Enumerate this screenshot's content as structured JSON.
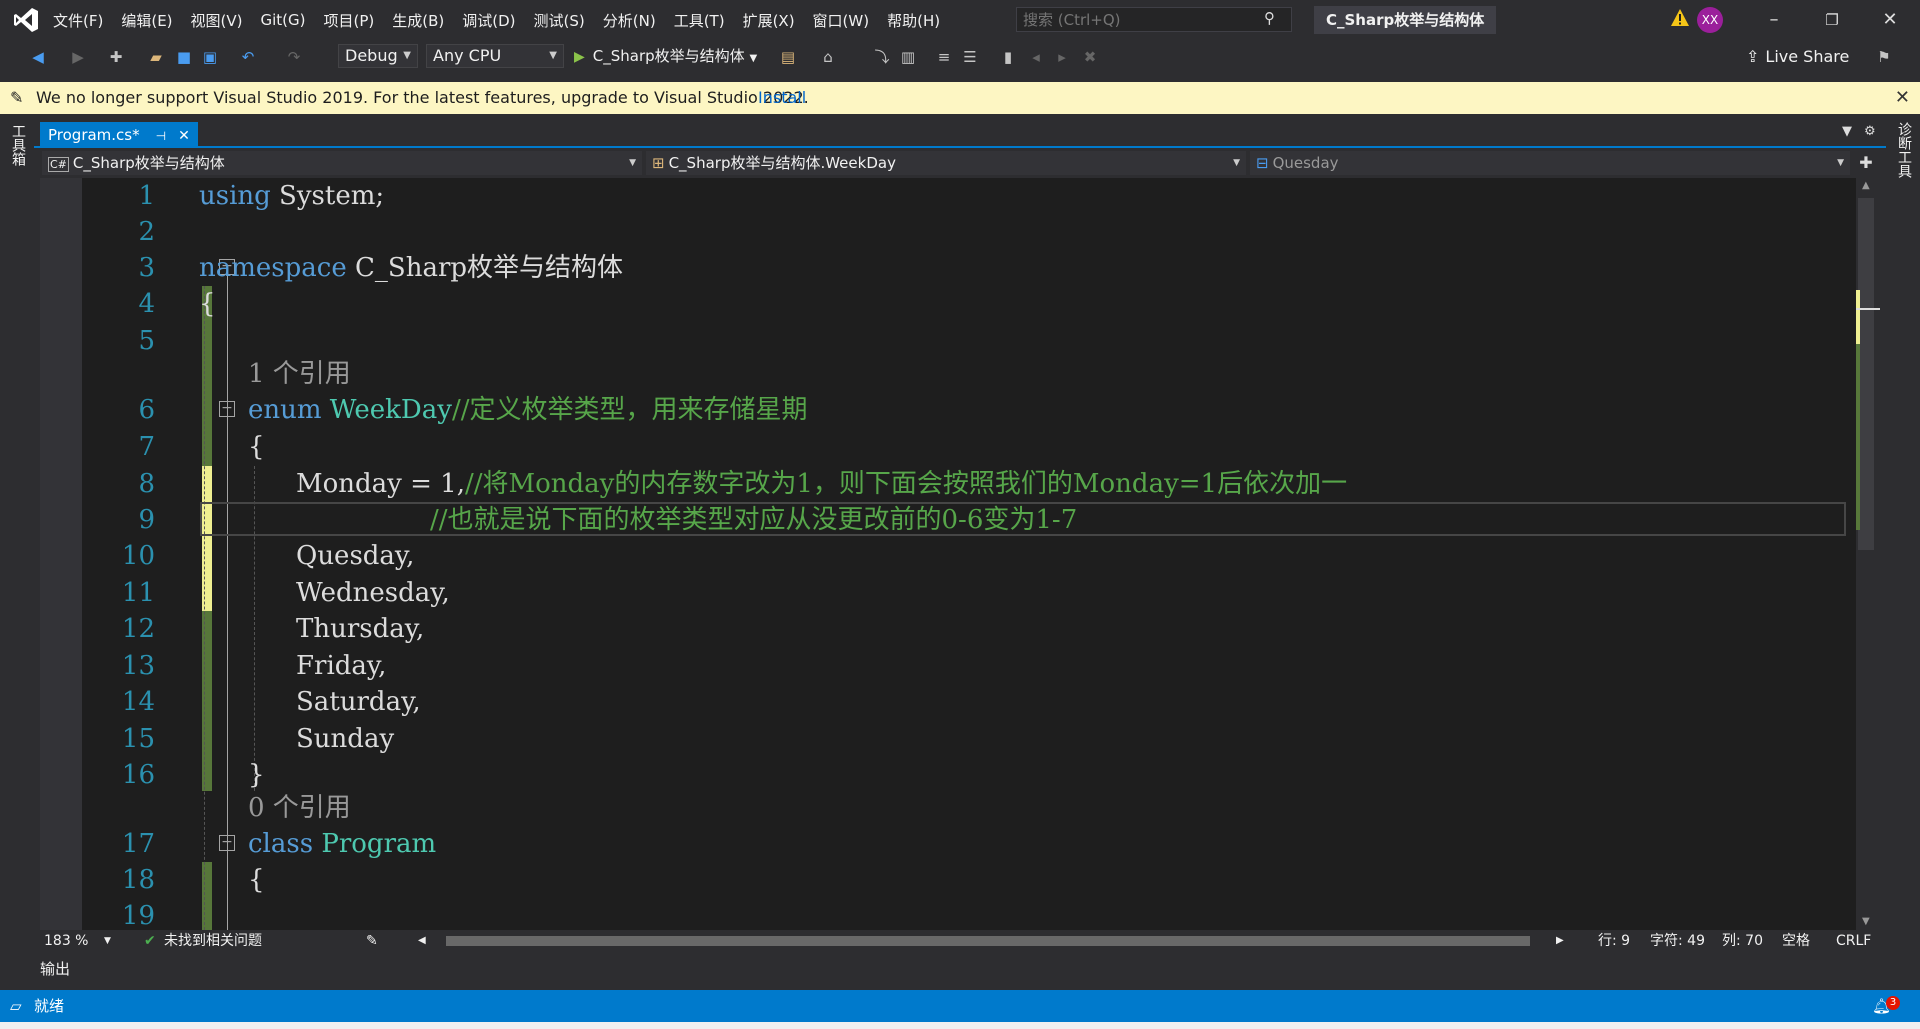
{
  "menu": [
    "文件(F)",
    "编辑(E)",
    "视图(V)",
    "Git(G)",
    "项目(P)",
    "生成(B)",
    "调试(D)",
    "测试(S)",
    "分析(N)",
    "工具(T)",
    "扩展(X)",
    "窗口(W)",
    "帮助(H)"
  ],
  "search": {
    "placeholder": "搜索 (Ctrl+Q)"
  },
  "solution_title": "C_Sharp枚举与结构体",
  "avatar": "XX",
  "toolbar": {
    "config": "Debug",
    "platform": "Any CPU",
    "run_label": "C_Sharp枚举与结构体",
    "live_share": "Live Share"
  },
  "infobar": {
    "message": "We no longer support Visual Studio 2019. For the latest features, upgrade to Visual Studio 2022.",
    "link": "Install"
  },
  "side": {
    "left": "工具箱",
    "right": "诊断工具"
  },
  "tab": {
    "label": "Program.cs*"
  },
  "nav": {
    "project": "C_Sharp枚举与结构体",
    "type": "C_Sharp枚举与结构体.WeekDay",
    "member": "Quesday"
  },
  "code": {
    "l1_kw": "using",
    "l1_rest": " System;",
    "l3_kw": "namespace",
    "l3_rest": " C_Sharp枚举与结构体",
    "l4": "{",
    "lens1": "1 个引用",
    "l6_kw": "enum",
    "l6_type": "WeekDay",
    "l6_cmt": "//定义枚举类型，用来存储星期",
    "l7": "{",
    "l8_code": "Monday = 1,",
    "l8_cmt": "//将Monday的内存数字改为1，则下面会按照我们的Monday=1后依次加一",
    "l9_cmt": "//也就是说下面的枚举类型对应从没更改前的0-6变为1-7",
    "l10": "Quesday,",
    "l11": "Wednesday,",
    "l12": "Thursday,",
    "l13": "Friday,",
    "l14": "Saturday,",
    "l15": "Sunday",
    "l16": "}",
    "lens2": "0 个引用",
    "l17_kw": "class",
    "l17_type": "Program",
    "l18": "{",
    "line_numbers": [
      "1",
      "2",
      "3",
      "4",
      "5",
      "6",
      "7",
      "8",
      "9",
      "10",
      "11",
      "12",
      "13",
      "14",
      "15",
      "16",
      "17",
      "18",
      "19"
    ]
  },
  "status_row": {
    "zoom": "183 %",
    "issues": "未找到相关问题",
    "line": "行: 9",
    "char": "字符: 49",
    "col": "列: 70",
    "spaces": "空格",
    "eol": "CRLF"
  },
  "output_label": "输出",
  "statusbar": {
    "ready": "就绪",
    "notifications": "3"
  },
  "colors": {
    "accent": "#007acc",
    "keyword": "#569cd6",
    "type": "#4ec9b0",
    "comment": "#57a64a",
    "linenum": "#2b91af",
    "changed_saved": "#57773a",
    "changed_unsaved": "#efef91"
  }
}
